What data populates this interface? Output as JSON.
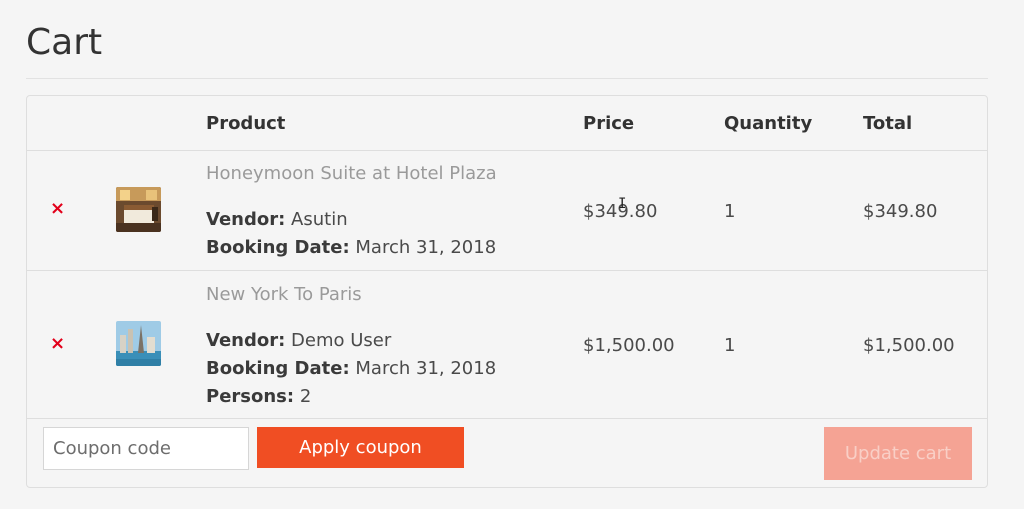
{
  "page": {
    "title": "Cart"
  },
  "table": {
    "headers": {
      "product": "Product",
      "price": "Price",
      "quantity": "Quantity",
      "total": "Total"
    },
    "remove_symbol": "×",
    "items": [
      {
        "name": "Honeymoon Suite at Hotel Plaza",
        "vendor_label": "Vendor:",
        "vendor": "Asutin",
        "booking_label": "Booking Date:",
        "booking_date": "March 31, 2018",
        "price": "$349.80",
        "quantity": "1",
        "total": "$349.80",
        "thumb": "hotel-room-image"
      },
      {
        "name": "New York To Paris",
        "vendor_label": "Vendor:",
        "vendor": "Demo User",
        "booking_label": "Booking Date:",
        "booking_date": "March 31, 2018",
        "persons_label": "Persons:",
        "persons": "2",
        "price": "$1,500.00",
        "quantity": "1",
        "total": "$1,500.00",
        "thumb": "paris-skyline-image"
      }
    ]
  },
  "actions": {
    "coupon_placeholder": "Coupon code",
    "apply_label": "Apply coupon",
    "update_label": "Update cart"
  },
  "colors": {
    "accent": "#f04e23",
    "accent_disabled": "#f5a394",
    "remove": "#e2001a"
  }
}
